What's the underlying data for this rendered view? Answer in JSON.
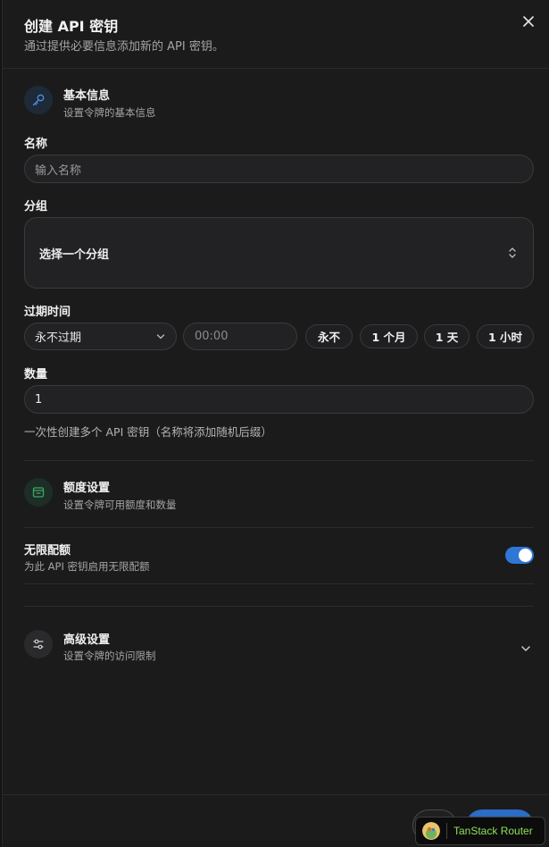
{
  "dialog": {
    "title": "创建 API 密钥",
    "description": "通过提供必要信息添加新的 API 密钥。"
  },
  "basic": {
    "title": "基本信息",
    "description": "设置令牌的基本信息",
    "icon": "key-icon"
  },
  "name_field": {
    "label": "名称",
    "placeholder": "输入名称"
  },
  "group_field": {
    "label": "分组",
    "value": "选择一个分组"
  },
  "expiry": {
    "label": "过期时间",
    "select_value": "永不过期",
    "time_placeholder": "00:00",
    "presets": [
      "永不",
      "1 个月",
      "1 天",
      "1 小时"
    ]
  },
  "quantity": {
    "label": "数量",
    "value": "1",
    "hint": "一次性创建多个 API 密钥（名称将添加随机后缀）"
  },
  "quota": {
    "title": "额度设置",
    "description": "设置令牌可用额度和数量",
    "icon": "wallet-icon",
    "accent": "#3fa66a"
  },
  "unlimited": {
    "label": "无限配额",
    "description": "为此 API 密钥启用无限配额",
    "enabled": true,
    "color": "#2f77d6"
  },
  "advanced": {
    "title": "高级设置",
    "description": "设置令牌的访问限制",
    "icon": "sliders-icon"
  },
  "devtools": {
    "label": "TanStack Router",
    "color": "#8ee05a"
  }
}
